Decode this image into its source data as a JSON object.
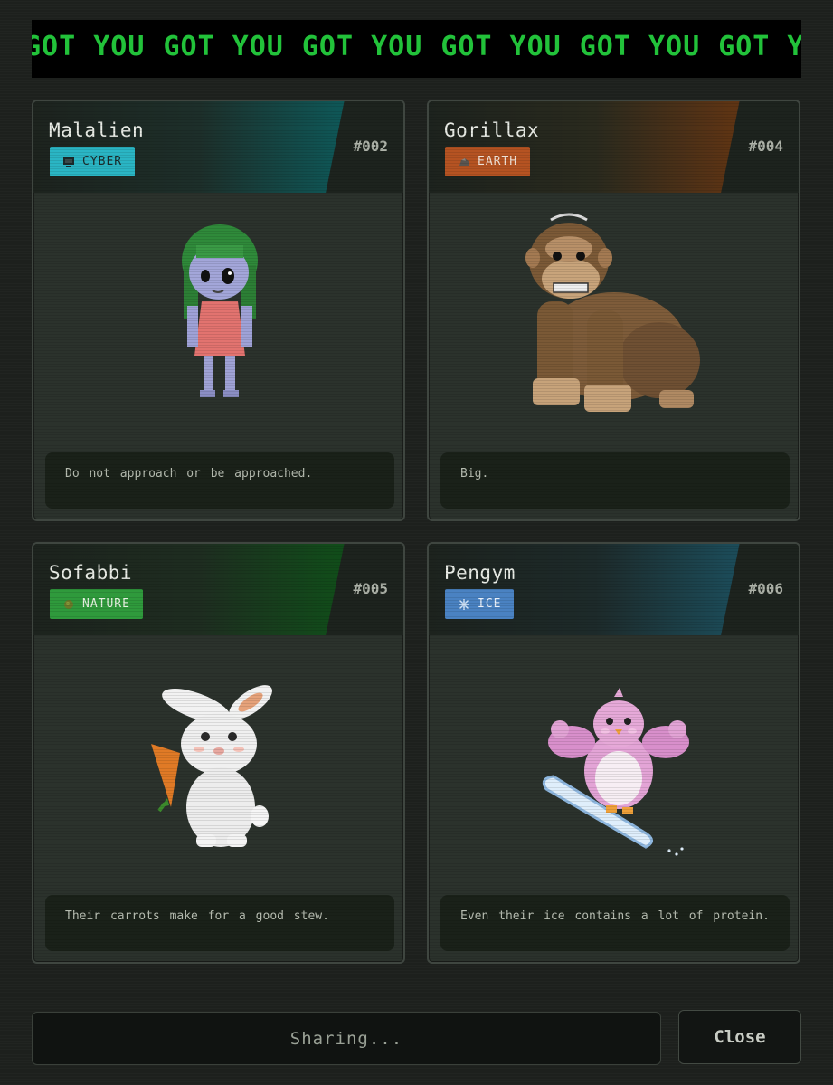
{
  "banner": {
    "repeat_text": "GOT YOU",
    "repeat_count": 7,
    "color": "#22c23a"
  },
  "cards": [
    {
      "name": "Malalien",
      "number": "#002",
      "type_label": "CYBER",
      "type_icon": "monitor-icon",
      "badge_color": "#2ab5c4",
      "glow_color": "#0d5a5a",
      "description": "Do not approach or be approached.",
      "creature": "alien-girl-sprite"
    },
    {
      "name": "Gorillax",
      "number": "#004",
      "type_label": "EARTH",
      "type_icon": "rock-icon",
      "badge_color": "#b55322",
      "glow_color": "#6a3512",
      "description": "Big.",
      "creature": "gorilla-sprite"
    },
    {
      "name": "Sofabbi",
      "number": "#005",
      "type_label": "NATURE",
      "type_icon": "leaf-icon",
      "badge_color": "#2f9a3c",
      "glow_color": "#145a1d",
      "description": "Their carrots make for a good stew.",
      "creature": "rabbit-sprite"
    },
    {
      "name": "Pengym",
      "number": "#006",
      "type_label": "ICE",
      "type_icon": "snowflake-icon",
      "badge_color": "#4a82c2",
      "glow_color": "#1f4c5c",
      "description": "Even their ice contains a lot of protein.",
      "creature": "penguin-sprite"
    }
  ],
  "footer": {
    "share_label": "Sharing...",
    "close_label": "Close"
  }
}
